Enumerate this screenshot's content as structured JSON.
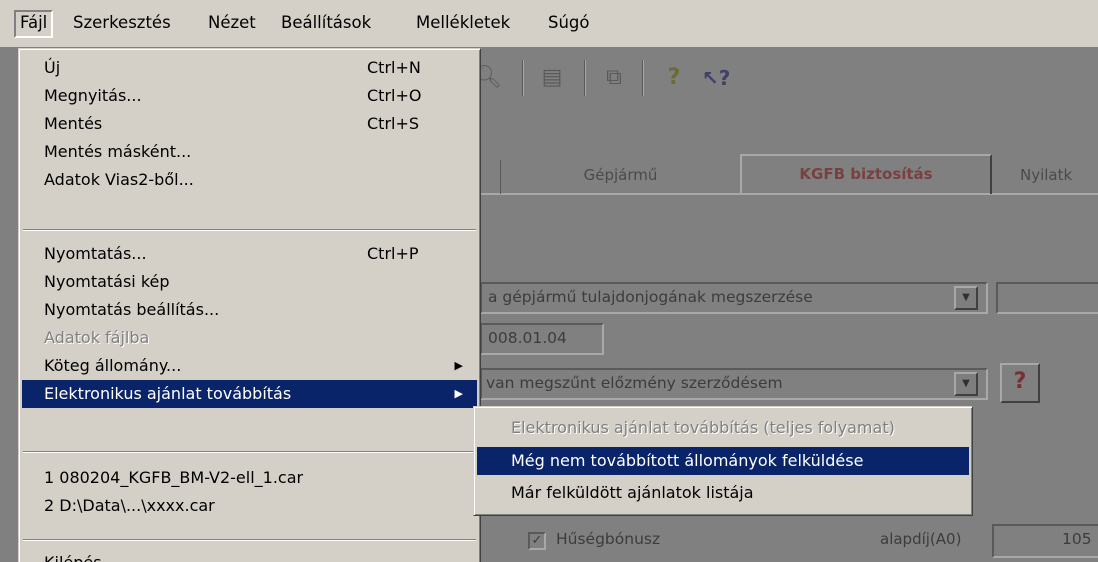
{
  "menubar": {
    "items": [
      "Fájl",
      "Szerkesztés",
      "Nézet",
      "Beállítások",
      "Mellékletek",
      "Súgó"
    ]
  },
  "file_menu": {
    "items": [
      {
        "label": "Új",
        "shortcut": "Ctrl+N"
      },
      {
        "label": "Megnyitás...",
        "shortcut": "Ctrl+O"
      },
      {
        "label": "Mentés",
        "shortcut": "Ctrl+S"
      },
      {
        "label": "Mentés másként...",
        "shortcut": ""
      },
      {
        "label": "Adatok Vias2-ből...",
        "shortcut": ""
      },
      {
        "label": "Nyomtatás...",
        "shortcut": "Ctrl+P"
      },
      {
        "label": "Nyomtatási kép",
        "shortcut": ""
      },
      {
        "label": "Nyomtatás beállítás...",
        "shortcut": ""
      },
      {
        "label": "Adatok fájlba",
        "shortcut": "",
        "disabled": true
      },
      {
        "label": "Köteg állomány...",
        "shortcut": "",
        "submenu": true
      },
      {
        "label": "Elektronikus ajánlat továbbítás",
        "shortcut": "",
        "submenu": true,
        "highlighted": true
      },
      {
        "label": "1 080204_KGFB_BM-V2-ell_1.car",
        "shortcut": ""
      },
      {
        "label": "2 D:\\Data\\...\\xxxx.car",
        "shortcut": ""
      },
      {
        "label": "Kilépés",
        "shortcut": ""
      }
    ]
  },
  "submenu": {
    "items": [
      {
        "label": "Elektronikus ajánlat továbbítás (teljes folyamat)",
        "disabled": true
      },
      {
        "label": "Még nem továbbított állományok felküldése",
        "highlighted": true
      },
      {
        "label": "Már felküldött ajánlatok listája"
      }
    ]
  },
  "background": {
    "tabs": [
      "Gépjármű",
      "KGFB biztosítás",
      "Nyilatk"
    ],
    "field1_text": "a gépjármű tulajdonjogának megszerzése",
    "date_text": "008.01.04",
    "field3_text": "van megszűnt előzmény szerződésem",
    "checkbox_label": "Hűségbónusz",
    "alapdij_label": "alapdíj(A0)",
    "alapdij_value": "105"
  },
  "colors": {
    "menu_bg": "#d4d0c8",
    "highlight": "#0a246a",
    "dimmed_bg": "#808080"
  }
}
